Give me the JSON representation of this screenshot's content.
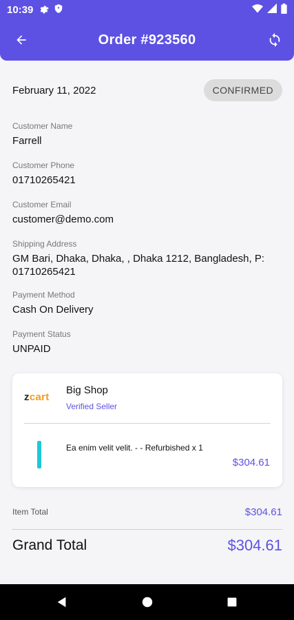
{
  "status_bar": {
    "time": "10:39",
    "icons": [
      "settings-icon",
      "shield-icon",
      "wifi-icon",
      "signal-icon",
      "battery-icon"
    ]
  },
  "app_bar": {
    "title": "Order #923560",
    "icons": [
      "back-arrow-icon",
      "refresh-icon"
    ]
  },
  "order": {
    "date": "February 11, 2022",
    "status": "CONFIRMED"
  },
  "fields": [
    {
      "label": "Customer Name",
      "value": "Farrell"
    },
    {
      "label": "Customer Phone",
      "value": "01710265421"
    },
    {
      "label": "Customer Email",
      "value": "customer@demo.com"
    },
    {
      "label": "Shipping Address",
      "value": "GM Bari, Dhaka, Dhaka, , Dhaka 1212, Bangladesh, P: 01710265421"
    },
    {
      "label": "Payment Method",
      "value": "Cash On Delivery"
    },
    {
      "label": "Payment Status",
      "value": "UNPAID"
    }
  ],
  "seller": {
    "logo": "zcart",
    "name": "Big Shop",
    "badge": "Verified Seller"
  },
  "item": {
    "name": "Ea enim velit velit. -  - Refurbished x 1",
    "price": "$304.61"
  },
  "totals": {
    "item_total_label": "Item Total",
    "item_total": "$304.61",
    "grand_total_label": "Grand Total",
    "grand_total": "$304.61"
  },
  "colors": {
    "primary": "#5d51e3",
    "badge_bg": "#dcdcdc",
    "accent_item": "#1ec7d9",
    "logo_orange": "#f39c1f"
  }
}
